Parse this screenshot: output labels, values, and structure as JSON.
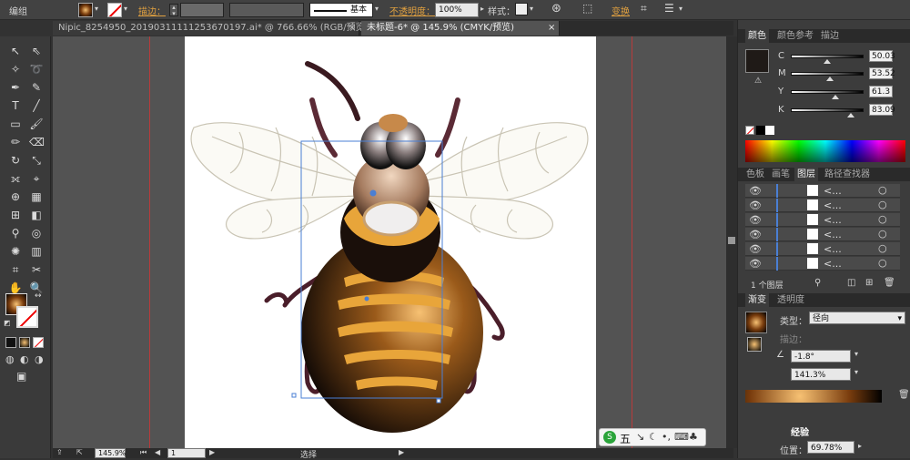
{
  "control_bar": {
    "group_label": "编组",
    "stroke_label": "描边：",
    "stroke_profile": "基本",
    "opacity_label": "不透明度：",
    "opacity_value": "100%",
    "style_label": "样式：",
    "transform_label": "变换"
  },
  "tabs": [
    {
      "label": "Nipic_8254950_20190311111253670197.ai* @ 766.66% (RGB/预览)",
      "active": false
    },
    {
      "label": "未标题-6* @ 145.9% (CMYK/预览)",
      "active": true
    }
  ],
  "color_panel": {
    "tabs": [
      "颜色",
      "颜色参考",
      "描边"
    ],
    "channels": [
      {
        "name": "C",
        "value": "50.03",
        "fraction": 0.5
      },
      {
        "name": "M",
        "value": "53.52",
        "fraction": 0.535
      },
      {
        "name": "Y",
        "value": "61.3",
        "fraction": 0.613
      },
      {
        "name": "K",
        "value": "83.09",
        "fraction": 0.83
      }
    ],
    "fill_color": "#1f1a17"
  },
  "layers_panel": {
    "tabs": [
      "色板",
      "画笔",
      "图层",
      "路径查找器"
    ],
    "rows": [
      "<...",
      "<...",
      "<...",
      "<...",
      "<...",
      "<..."
    ],
    "layer_count": "1 个图层"
  },
  "gradient_panel": {
    "tabs": [
      "渐变",
      "透明度"
    ],
    "type_label": "类型：",
    "type_value": "径向",
    "stroke_label": "描边：",
    "angle_value": "-1.8°",
    "aspect_value": "141.3%",
    "position_label": "位置：",
    "position_value": "69.78%"
  },
  "status_bar": {
    "zoom": "145.9%",
    "artboard": "1",
    "tool": "选择"
  },
  "ime_bar": {
    "label": "五"
  },
  "watermark": "经验"
}
